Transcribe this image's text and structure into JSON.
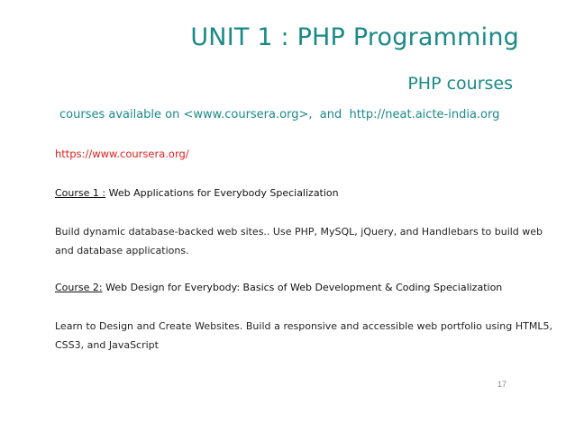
{
  "header": {
    "title": "UNIT 1 : PHP Programming",
    "subtitle": "PHP courses"
  },
  "availability": {
    "text_prefix": "courses available on <www.coursera.org>,  and  http://neat.aicte-india.org"
  },
  "main_link": "https://www.coursera.org/",
  "courses": [
    {
      "label": "Course 1 :",
      "name": " Web Applications for Everybody Specialization",
      "description": "Build dynamic database-backed web sites.. Use PHP, MySQL, jQuery, and Handlebars to build web and database applications."
    },
    {
      "label": "Course 2:",
      "name": " Web Design for Everybody: Basics of Web Development & Coding Specialization",
      "description": "Learn to Design and Create Websites. Build a responsive and accessible web portfolio using HTML5, CSS3, and JavaScript"
    }
  ],
  "footer": {
    "page_number": "17"
  },
  "colors": {
    "accent": "#1a8a87",
    "link": "#e02020",
    "text": "#222222"
  }
}
